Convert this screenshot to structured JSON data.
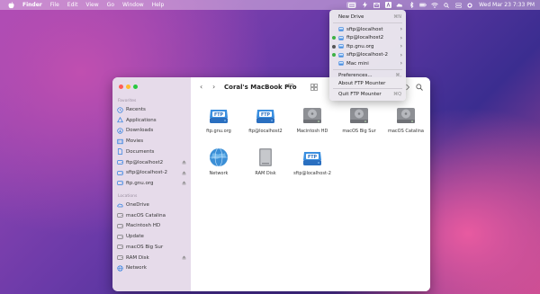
{
  "menubar": {
    "app": "Finder",
    "items": [
      "File",
      "Edit",
      "View",
      "Go",
      "Window",
      "Help"
    ],
    "clock": "Wed Mar 23  7:33 PM"
  },
  "dropdown": {
    "new_drive": "New Drive",
    "new_drive_shortcut": "⌘N",
    "servers": [
      {
        "label": "sftp@localhost",
        "connected": false
      },
      {
        "label": "ftp@localhost2",
        "connected": true
      },
      {
        "label": "ftp.gnu.org",
        "connected": true
      },
      {
        "label": "sftp@localhost-2",
        "connected": true
      },
      {
        "label": "Mac mini",
        "connected": false
      }
    ],
    "preferences": "Preferences...",
    "preferences_shortcut": "⌘,",
    "about": "About FTP Mounter",
    "quit": "Quit FTP Mounter",
    "quit_shortcut": "⌘Q"
  },
  "window": {
    "title": "Coral's MacBook Pro",
    "sidebar": {
      "favorites_heading": "Favorites",
      "favorites": [
        {
          "label": "Recents",
          "icon": "clock-icon"
        },
        {
          "label": "Applications",
          "icon": "applications-icon"
        },
        {
          "label": "Downloads",
          "icon": "download-icon"
        },
        {
          "label": "Movies",
          "icon": "movies-icon"
        },
        {
          "label": "Documents",
          "icon": "document-icon"
        },
        {
          "label": "ftp@localhost2",
          "icon": "drive-icon",
          "eject": true
        },
        {
          "label": "sftp@localhost-2",
          "icon": "drive-icon",
          "eject": true
        },
        {
          "label": "ftp.gnu.org",
          "icon": "drive-icon",
          "eject": true
        }
      ],
      "locations_heading": "Locations",
      "locations": [
        {
          "label": "OneDrive",
          "icon": "cloud-icon"
        },
        {
          "label": "macOS Catalina",
          "icon": "disk-icon"
        },
        {
          "label": "Macintosh HD",
          "icon": "disk-icon"
        },
        {
          "label": "Update",
          "icon": "disk-icon"
        },
        {
          "label": "macOS Big Sur",
          "icon": "disk-icon"
        },
        {
          "label": "RAM Disk",
          "icon": "disk-icon",
          "eject": true
        },
        {
          "label": "Network",
          "icon": "globe-icon"
        }
      ]
    },
    "files": [
      {
        "label": "ftp.gnu.org",
        "type": "ftp"
      },
      {
        "label": "ftp@localhost2",
        "type": "ftp"
      },
      {
        "label": "Macintosh HD",
        "type": "hd"
      },
      {
        "label": "macOS Big Sur",
        "type": "hd"
      },
      {
        "label": "macOS Catalina",
        "type": "hd"
      },
      {
        "label": "Network",
        "type": "network"
      },
      {
        "label": "RAM Disk",
        "type": "ram"
      },
      {
        "label": "sftp@localhost-2",
        "type": "ftp"
      }
    ],
    "ftp_badge": "FTP"
  },
  "colors": {
    "accent": "#2f7fe0",
    "connected_dot": "#3cb043",
    "disconnected_dot": "#555555"
  }
}
